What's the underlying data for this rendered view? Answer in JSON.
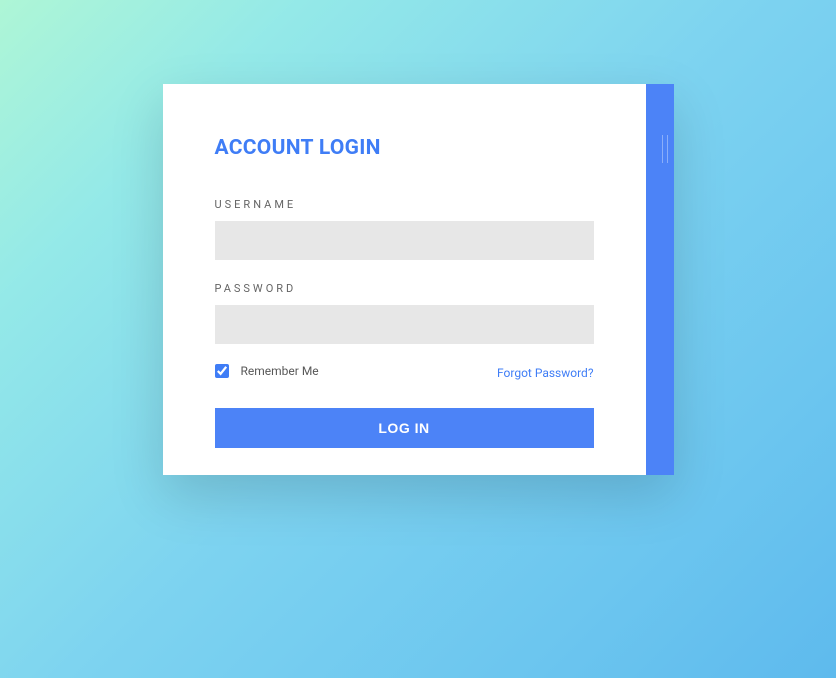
{
  "title": "ACCOUNT LOGIN",
  "fields": {
    "username": {
      "label": "USERNAME",
      "value": ""
    },
    "password": {
      "label": "PASSWORD",
      "value": ""
    }
  },
  "remember": {
    "label": "Remember Me",
    "checked": true
  },
  "forgot_link": "Forgot Password?",
  "submit_label": "LOG IN",
  "colors": {
    "accent": "#4c83f7",
    "link": "#3f7df6",
    "input_bg": "#e7e7e7"
  }
}
